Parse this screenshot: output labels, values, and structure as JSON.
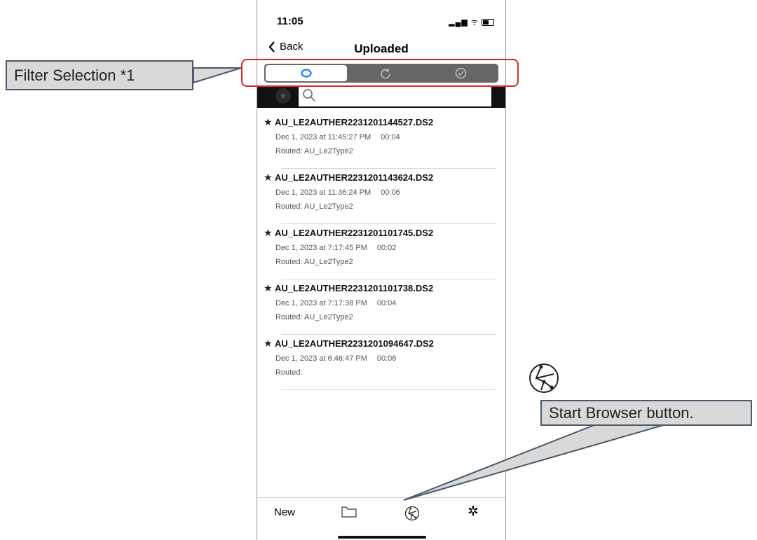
{
  "status_bar": {
    "time": "11:05",
    "icons": "signal wifi battery"
  },
  "nav": {
    "back_label": "Back",
    "title": "Uploaded"
  },
  "filter": {
    "segments": [
      {
        "icon": "cloud-icon",
        "active": true
      },
      {
        "icon": "refresh-icon",
        "active": false
      },
      {
        "icon": "check-circle-icon",
        "active": false
      }
    ]
  },
  "search": {
    "placeholder": "",
    "star_icon": "star-icon"
  },
  "recordings": [
    {
      "name": "AU_LE2AUTHER2231201144527.DS2",
      "date": "Dec 1, 2023 at 11:45:27 PM",
      "duration": "00:04",
      "route": "Routed: AU_Le2Type2"
    },
    {
      "name": "AU_LE2AUTHER2231201143624.DS2",
      "date": "Dec 1, 2023 at 11:36:24 PM",
      "duration": "00:06",
      "route": "Routed: AU_Le2Type2"
    },
    {
      "name": "AU_LE2AUTHER2231201101745.DS2",
      "date": "Dec 1, 2023 at 7:17:45 PM",
      "duration": "00:02",
      "route": "Routed: AU_Le2Type2"
    },
    {
      "name": "AU_LE2AUTHER2231201101738.DS2",
      "date": "Dec 1, 2023 at 7:17:38 PM",
      "duration": "00:04",
      "route": "Routed: AU_Le2Type2"
    },
    {
      "name": "AU_LE2AUTHER2231201094647.DS2",
      "date": "Dec 1, 2023 at 6:46:47 PM",
      "duration": "00:06",
      "route": "Routed:"
    }
  ],
  "tabbar": {
    "new_label": "New",
    "folder_icon": "folder-icon",
    "browser_icon": "browser-icon",
    "settings_icon": "gear-icon"
  },
  "annotations": {
    "filter_callout": "Filter Selection *1",
    "browser_callout": "Start Browser button.",
    "highlight_color": "#d62828",
    "callout_fill": "#d9d9d9",
    "callout_border": "#4a5a6a"
  }
}
